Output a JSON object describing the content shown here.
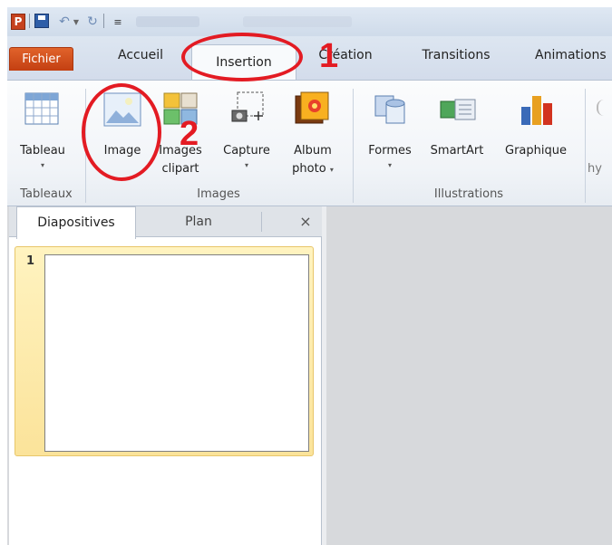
{
  "quick_access": {
    "app_icon": "P",
    "icons": [
      "powerpoint-app-icon",
      "save-icon",
      "undo-icon",
      "redo-icon",
      "customize-toolbar-icon"
    ]
  },
  "tabs": {
    "fichier": "Fichier",
    "accueil": "Accueil",
    "insertion": "Insertion",
    "creation": "Création",
    "transitions": "Transitions",
    "animations": "Animations"
  },
  "ribbon": {
    "tableau": "Tableau",
    "image": "Image",
    "images_clipart_1": "Images",
    "images_clipart_2": "clipart",
    "capture": "Capture",
    "album_1": "Album",
    "album_2": "photo",
    "formes": "Formes",
    "smartart": "SmartArt",
    "graphique": "Graphique",
    "cut_off": "hy",
    "dropdown": "▾",
    "groups": {
      "tableaux": "Tableaux",
      "images": "Images",
      "illustrations": "Illustrations"
    }
  },
  "pane": {
    "tab_diapositives": "Diapositives",
    "tab_plan": "Plan",
    "close": "×",
    "slide_number": "1"
  },
  "annotations": {
    "step1": "1",
    "step2": "2"
  },
  "colors": {
    "file_tab": "#d44d1d",
    "annotation_red": "#e31b23",
    "selected_slide": "#fbe39a"
  }
}
